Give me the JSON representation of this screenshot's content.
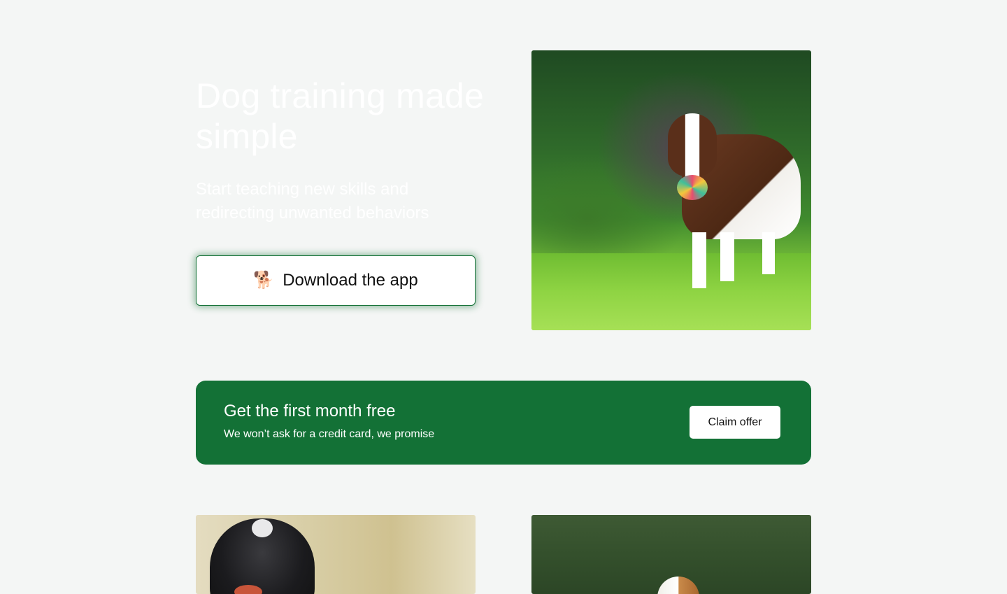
{
  "hero": {
    "title": "Dog training made simple",
    "subtitle": "Start teaching new skills and redirecting unwanted behaviors",
    "download_button": {
      "emoji": "🐕",
      "label": "Download the app"
    },
    "image_alt": "Brown and white border collie running on grass with a colorful ball"
  },
  "offer": {
    "title": "Get the first month free",
    "subtitle": "We won’t ask for a credit card, we promise",
    "button_label": "Claim offer"
  },
  "gallery": {
    "left_image_alt": "Black and white spaniel puppy chewing a toy",
    "right_image_alt": "Collie dog running in a green field"
  },
  "colors": {
    "background": "#f4f6f5",
    "brand_green": "#137136",
    "button_background": "#ffffff"
  }
}
